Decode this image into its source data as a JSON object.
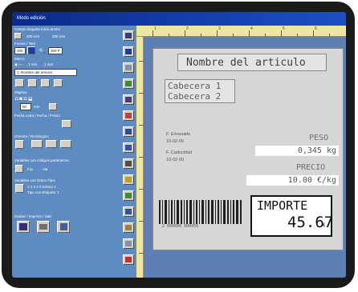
{
  "window": {
    "title": "Modo edición"
  },
  "left_panel": {
    "section_fields": "Campo etiqueta Inicio ancho",
    "size_opt1": "400 mm",
    "size_opt2": "400 mm",
    "section_font": "Fuente / Tam",
    "font_size_value": "300",
    "font_style_value": "300 P",
    "section_borders": "Marco",
    "line_opt1": "1 mm",
    "line_opt2": "1 mm",
    "field_name_value": "1. Nombre del articulo",
    "section_objects": "Objetos",
    "spacing_value": "50",
    "spacing_unit": "mm",
    "section_date": "Fecha Letra / Fecha / Precio",
    "section_orientation": "Orientar / Rectángulo",
    "section_variables": "Variables con códigos parámetros",
    "check_opt1": "Fijo",
    "check_opt2": "Var",
    "section_barcode": "Variables con Datos Fijos",
    "barcode_note1": "1 2 3 4 5  Entero 1",
    "barcode_note2": "Tipo con Etiqueta: 1",
    "section_save": "Grabar / Imprimir / Salir"
  },
  "ruler": {
    "numbers": [
      "1",
      "2",
      "3",
      "4",
      "5",
      "6"
    ]
  },
  "label": {
    "title": "Nombre del articulo",
    "header1": "Cabecera 1",
    "header2": "Cabecera 2",
    "packed_label": "F. Envasado",
    "packed_date": "10-02-00",
    "expiry_label": "F. Caducidad",
    "expiry_date": "10-02-00",
    "weight_label": "PESO",
    "weight_value": "0,345 kg",
    "price_label": "PRECIO",
    "price_value": "10.00 €/kg",
    "total_label": "IMPORTE",
    "total_value": "45.67",
    "total_currency": "€",
    "barcode_text": "2 000000 000456"
  },
  "colors": {
    "frame": "#1a1a1a",
    "screen_bg": "#0c2f96",
    "panel": "#5d8bc2",
    "workspace": "#5d7fb4",
    "ruler": "#ece6a0",
    "label_card": "#d6d6d6"
  },
  "toolbar_icons": [
    "pencil-icon",
    "text-icon",
    "line-icon",
    "image-icon",
    "box-icon",
    "list-icon",
    "calendar-icon",
    "edit-icon",
    "barcode-icon",
    "paint-icon",
    "contrast-icon",
    "disk-icon",
    "ruler-icon",
    "pen-icon",
    "stop-icon"
  ]
}
